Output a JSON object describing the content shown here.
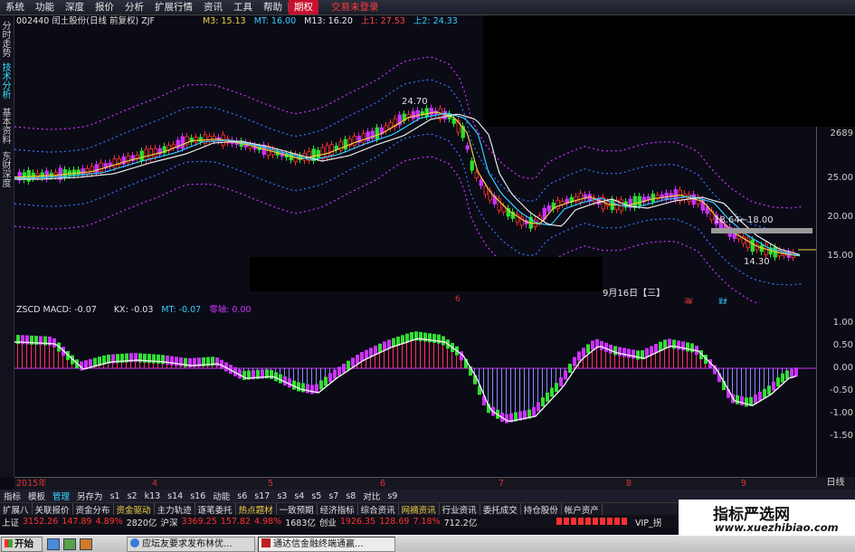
{
  "menu": {
    "items": [
      "系统",
      "功能",
      "深度",
      "报价",
      "分析",
      "扩展行情",
      "资讯",
      "工具",
      "帮助"
    ],
    "selected": "期权",
    "right_item": "交易未登录"
  },
  "side_tabs": [
    "分时走势",
    "技术分析",
    "基本资料",
    "东财深度"
  ],
  "chart_header": {
    "code_name": "002440 闰土股份(日线 前复权) ZJF",
    "m3": "M3: 15.13",
    "mt": "MT: 16.00",
    "m13": "M13: 16.20",
    "up1": "上1: 27.53",
    "up2": "上2: 24.33"
  },
  "annotations": {
    "high_label": "24.70",
    "mid_label": "18.64←18.00",
    "low_label": "14.30",
    "date_label": "9月16日【三】",
    "zhang": "涨",
    "cai": "财",
    "month_marker": "6"
  },
  "macd_header": {
    "name": "ZSCD MACD: -0.07",
    "kx": "KX: -0.03",
    "mt": "MT: -0.07",
    "zero": "零轴: 0.00"
  },
  "price_scale": [
    "2689",
    "25.00",
    "20.00",
    "15.00"
  ],
  "macd_scale": [
    "1.00",
    "0.50",
    "0.00",
    "-0.50",
    "-1.00",
    "-1.50"
  ],
  "timeline": [
    "2015年",
    "4",
    "5",
    "6",
    "7",
    "8",
    "9"
  ],
  "timeline_period": "日线",
  "indicator_tabs": [
    "指标",
    "模板",
    "管理",
    "另存为",
    "s1",
    "s2",
    "k13",
    "s14",
    "s16",
    "动能",
    "s6",
    "s17",
    "s3",
    "s4",
    "s5",
    "s7",
    "s8",
    "对比",
    "s9"
  ],
  "function_tabs": [
    "扩展八",
    "关联报价",
    "资金分布",
    "资金驱动",
    "主力轨迹",
    "逐笔委托",
    "热点题材",
    "一致预期",
    "经济指标",
    "综合资讯",
    "网摘资讯",
    "行业资讯",
    "委托成交",
    "持仓股份",
    "帐户资产"
  ],
  "market": {
    "sh_label": "上证",
    "sh_val": "3152.26",
    "sh_chg": "147.89",
    "sh_pct": "4.89%",
    "sh_amt": "2820亿",
    "sz_label": "沪深",
    "sz_val": "3369.25",
    "sz_chg": "157.82",
    "sz_pct": "4.98%",
    "sz_amt": "1683亿",
    "cy_label": "创业",
    "cy_val": "1926.35",
    "cy_chg": "128.69",
    "cy_pct": "7.18%",
    "cy_amt": "712.2亿",
    "vip": "VIP_拐"
  },
  "taskbar": {
    "start": "开始",
    "items": [
      "应坛友要求发布林优...",
      "通达信金融终端通赢..."
    ]
  },
  "watermark": {
    "title": "指标严选网",
    "url": "www.xuezhibiao.com"
  },
  "colors": {
    "up": "#ff3030",
    "down": "#2de02d",
    "bullish_macd": "#cc33ff",
    "bearish_macd": "#33dd33",
    "accent": "#33e0ff"
  }
}
